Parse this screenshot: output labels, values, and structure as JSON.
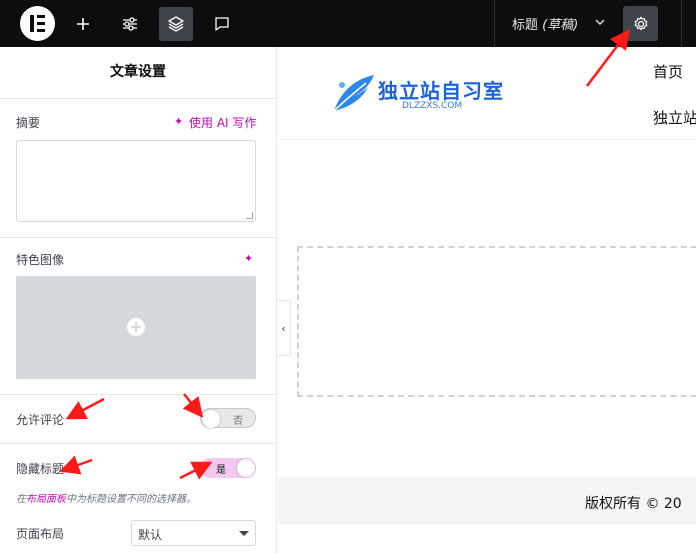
{
  "topbar": {
    "logo": "elementor-logo",
    "add_icon": "plus-icon",
    "settings_icon": "sliders-icon",
    "structure_icon": "layers-icon",
    "notes_icon": "comment-icon",
    "doc_title": "标题",
    "doc_status": "(草稿)",
    "page_settings_icon": "gear-icon"
  },
  "panel": {
    "title": "文章设置",
    "excerpt_label": "摘要",
    "ai_write": "使用 AI 写作",
    "featured_image_label": "特色图像",
    "allow_comments_label": "允许评论",
    "allow_comments_toggle": "否",
    "hide_title_label": "隐藏标题",
    "hide_title_toggle": "是",
    "hint_prefix": "在",
    "hint_link": "布局面板",
    "hint_suffix": "中为标题设置不同的选择器。",
    "page_layout_label": "页面布局",
    "page_layout_value": "默认"
  },
  "canvas": {
    "brand_name": "独立站自习室",
    "brand_domain": "DLZZXS.COM",
    "nav_items": [
      "首页",
      "独立站"
    ],
    "footer_text": "版权所有 © 20"
  },
  "colors": {
    "topbar": "#0c0d0e",
    "accent_pink": "#c00bb9",
    "toggle_on": "#f3c9ef",
    "brand_blue": "#1a63d8",
    "annotation_red": "#ff1a1a"
  }
}
